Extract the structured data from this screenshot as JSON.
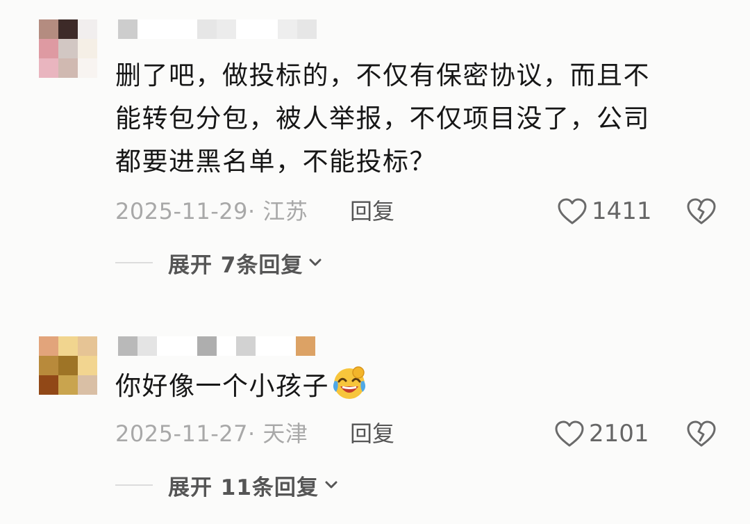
{
  "comments": [
    {
      "avatar_colors": [
        "#b48c80",
        "#3d2a28",
        "#f1eeee",
        "#de9aa2",
        "#d2c7c3",
        "#f5efe6",
        "#e9b5bf",
        "#d0b9b1",
        "#f8f4f1"
      ],
      "username_colors": [
        "#cdcdcd",
        "#ffffff",
        "#ffffff",
        "#e6e6e6",
        "#ececec",
        "#ffffff",
        "#eeeeee",
        "#e6e6e6"
      ],
      "text_lines": [
        "删了吧，做投标的，不仅有保密协议，而且不",
        "能转包分包，被人举报，不仅项目没了，公司",
        "都要进黑名单，不能投标？"
      ],
      "date_location": "2025-11-29· 江苏",
      "reply_label": "回复",
      "likes": "1411",
      "expand_label": "展开 7条回复"
    },
    {
      "avatar_colors": [
        "#e2a47b",
        "#f1d58f",
        "#e6c495",
        "#b88a3b",
        "#9e7426",
        "#f2d590",
        "#914817",
        "#c9a44e",
        "#d9bfa5"
      ],
      "username_colors": [
        "#b9b9b9",
        "#e4e4e4",
        "#ffffff",
        "#aeaeae",
        "#ffffff",
        "#d2d2d2",
        "#ffffff",
        "#dca265"
      ],
      "text": "你好像一个小孩子",
      "emoji_name": "laughing-crying-face",
      "date_location": "2025-11-27· 天津",
      "reply_label": "回复",
      "likes": "2101",
      "expand_label": "展开 11条回复"
    }
  ]
}
